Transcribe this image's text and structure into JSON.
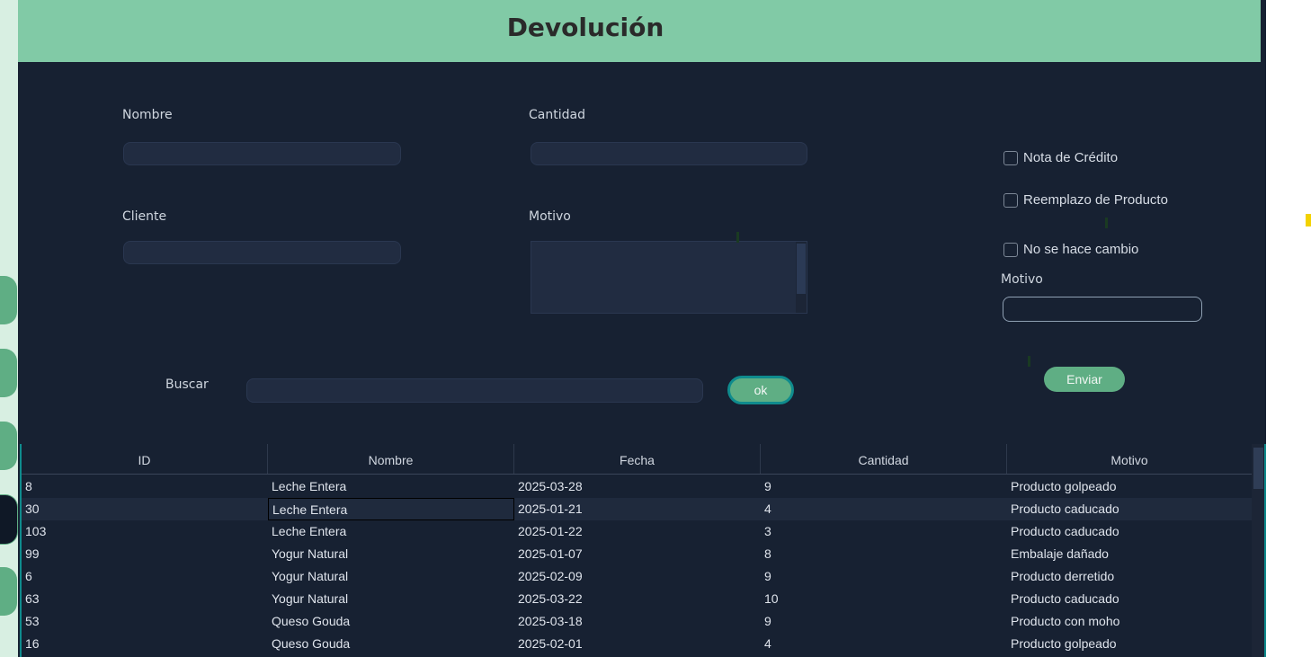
{
  "header": {
    "title": "Devolución"
  },
  "form": {
    "nombre_label": "Nombre",
    "nombre_value": "",
    "cantidad_label": "Cantidad",
    "cantidad_value": "",
    "cliente_label": "Cliente",
    "cliente_value": "",
    "motivo_label": "Motivo",
    "motivo_value": "",
    "buscar_label": "Buscar",
    "buscar_value": "",
    "ok_label": "ok"
  },
  "options": {
    "nota_credito": "Nota de Crédito",
    "reemplazo": "Reemplazo de Producto",
    "no_cambio": "No se hace cambio",
    "motivo_label": "Motivo",
    "motivo_value": "",
    "enviar_label": "Enviar"
  },
  "table": {
    "columns": [
      "ID",
      "Nombre",
      "Fecha",
      "Cantidad",
      "Motivo"
    ],
    "rows": [
      [
        "8",
        "Leche Entera",
        "2025-03-28",
        "9",
        "Producto golpeado"
      ],
      [
        "30",
        "Leche Entera",
        "2025-01-21",
        "4",
        "Producto caducado"
      ],
      [
        "103",
        "Leche Entera",
        "2025-01-22",
        "3",
        "Producto caducado"
      ],
      [
        "99",
        "Yogur Natural",
        "2025-01-07",
        "8",
        "Embalaje dañado"
      ],
      [
        "6",
        "Yogur Natural",
        "2025-02-09",
        "9",
        "Producto derretido"
      ],
      [
        "63",
        "Yogur Natural",
        "2025-03-22",
        "10",
        "Producto caducado"
      ],
      [
        "53",
        "Queso Gouda",
        "2025-03-18",
        "9",
        "Producto con moho"
      ],
      [
        "16",
        "Queso Gouda",
        "2025-02-01",
        "4",
        "Producto golpeado"
      ]
    ]
  },
  "colors": {
    "header_bg": "#81caa6",
    "panel_bg": "#172132",
    "accent": "#5fae84",
    "teal_border": "#0f8b8d"
  }
}
